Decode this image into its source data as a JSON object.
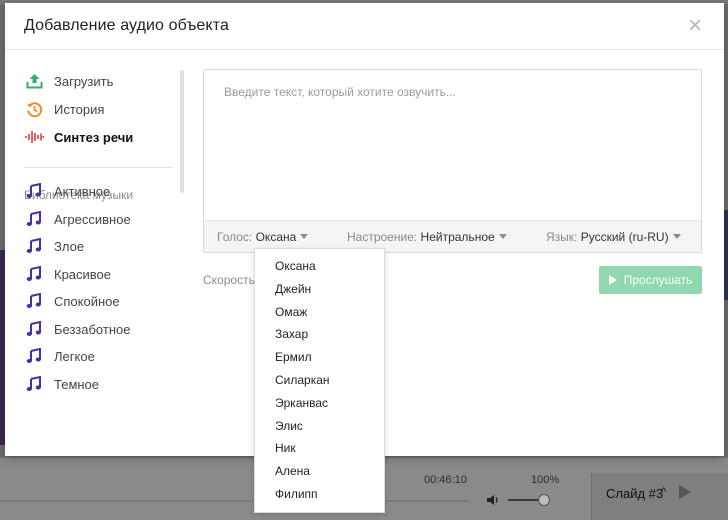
{
  "background": {
    "time": "00:46:10",
    "zoom": "100%",
    "slide_label": "Слайд #3",
    "slide_chevron": "^"
  },
  "modal": {
    "title": "Добавление аудио объекта",
    "close_glyph": "×"
  },
  "sidebar": {
    "items": [
      {
        "label": "Загрузить",
        "icon": "upload-icon"
      },
      {
        "label": "История",
        "icon": "history-icon"
      },
      {
        "label": "Синтез речи",
        "icon": "waveform-icon"
      }
    ],
    "music_section_title": "Библиотека музыки",
    "music_items": [
      {
        "label": "Активное"
      },
      {
        "label": "Агрессивное"
      },
      {
        "label": "Злое"
      },
      {
        "label": "Красивое"
      },
      {
        "label": "Спокойное"
      },
      {
        "label": "Беззаботное"
      },
      {
        "label": "Легкое"
      },
      {
        "label": "Темное"
      }
    ]
  },
  "editor": {
    "placeholder": "Введите текст, который хотите озвучить...",
    "voice_label": "Голос:",
    "voice_value": "Оксана",
    "mood_label": "Настроение:",
    "mood_value": "Нейтральное",
    "lang_label": "Язык:",
    "lang_value": "Русский (ru-RU)",
    "speed_label": "Скорость",
    "listen_label": "Прослушать"
  },
  "voice_dropdown": {
    "options": [
      "Оксана",
      "Джейн",
      "Омаж",
      "Захар",
      "Ермил",
      "Силаркан",
      "Эрканвас",
      "Элис",
      "Ник",
      "Алена",
      "Филипп"
    ]
  },
  "colors": {
    "upload_icon": "#2eb06a",
    "history_icon": "#f08a2d",
    "waveform_icon": "#e0413b",
    "music_icon": "#4a2fa0",
    "listen_button": "#8fd8b0"
  }
}
